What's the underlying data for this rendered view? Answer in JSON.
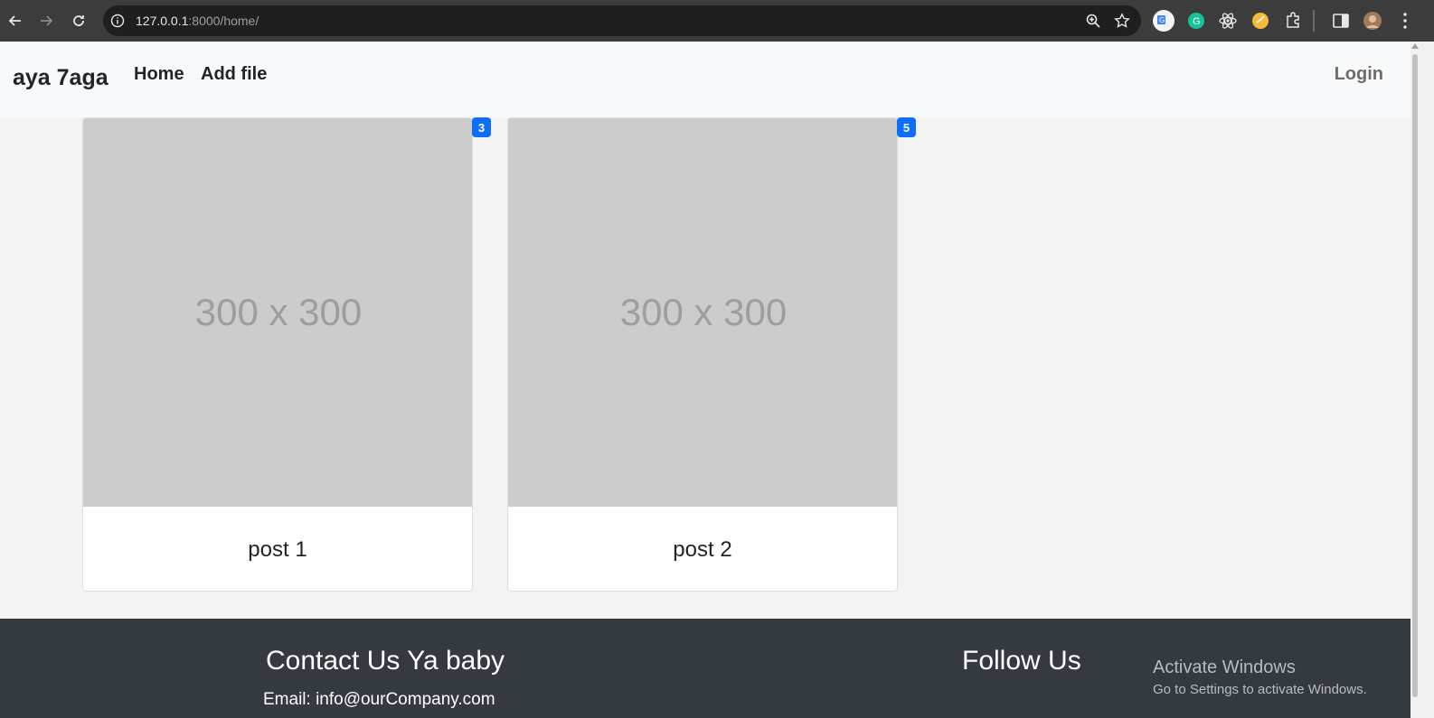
{
  "browser": {
    "url_host": "127.0.0.1",
    "url_rest": ":8000/home/"
  },
  "navbar": {
    "brand": "aya 7aga",
    "links": [
      "Home",
      "Add file"
    ],
    "login": "Login"
  },
  "cards": [
    {
      "image_text": "300 x 300",
      "caption": "post 1",
      "badge": "3"
    },
    {
      "image_text": "300 x 300",
      "caption": "post 2",
      "badge": "5"
    }
  ],
  "footer": {
    "contact_title": "Contact Us Ya baby",
    "email": "Email: info@ourCompany.com",
    "follow_title": "Follow Us"
  },
  "watermark": {
    "line1": "Activate Windows",
    "line2": "Go to Settings to activate Windows."
  },
  "colors": {
    "badge": "#0d6efd",
    "footer": "#343a40",
    "navbar": "#f8f9fa"
  }
}
